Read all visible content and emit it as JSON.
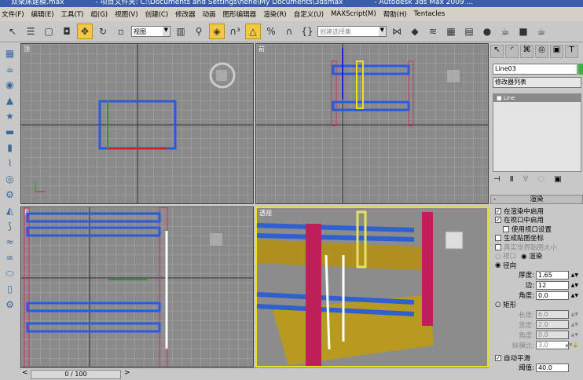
{
  "title": {
    "file": "双架床建模.max",
    "project": "- 项目文件夹: C:\\Documents and Settings\\hehe\\My Documents\\3dsmax",
    "app": "- Autodesk 3ds Max  2009 ..."
  },
  "menu": [
    "文件(F)",
    "编辑(E)",
    "工具(T)",
    "组(G)",
    "视图(V)",
    "创建(C)",
    "修改器",
    "动画",
    "图形编辑器",
    "渲染(R)",
    "自定义(U)",
    "MAXScript(M)",
    "帮助(H)",
    "Tentacles"
  ],
  "toolbar": {
    "ref_coord": "视图",
    "named_selection": "创建选择集"
  },
  "viewports": {
    "top": "顶",
    "front": "前",
    "left": "左",
    "perspective": "透视"
  },
  "panel": {
    "object_name": "Line03",
    "modifier_list": "修改器列表",
    "stack_item": "Line"
  },
  "rendering": {
    "title": "渲染",
    "collapse": "-",
    "enable_in_renderer": "在渲染中启用",
    "enable_in_viewport": "在视口中启用",
    "use_viewport_settings": "使用视口设置",
    "gen_mapping": "生成贴图坐标",
    "real_world": "真实世界贴图大小",
    "viewport_radio": "视口",
    "render_radio": "渲染",
    "radial": "径向",
    "thickness_label": "厚度:",
    "thickness": "1.65",
    "sides_label": "边:",
    "sides": "12",
    "angle_label": "角度:",
    "angle": "0.0",
    "rect": "矩形",
    "length_label": "长度:",
    "length": "6.0",
    "width_label": "宽度:",
    "width": "2.0",
    "rect_angle_label": "角度:",
    "rect_angle": "0.0",
    "aspect_label": "纵横比:",
    "aspect": "3.0",
    "auto_smooth": "自动平滑",
    "threshold_label": "阈值:",
    "threshold": "40.0"
  },
  "timeline": {
    "frame": "0 / 100"
  }
}
